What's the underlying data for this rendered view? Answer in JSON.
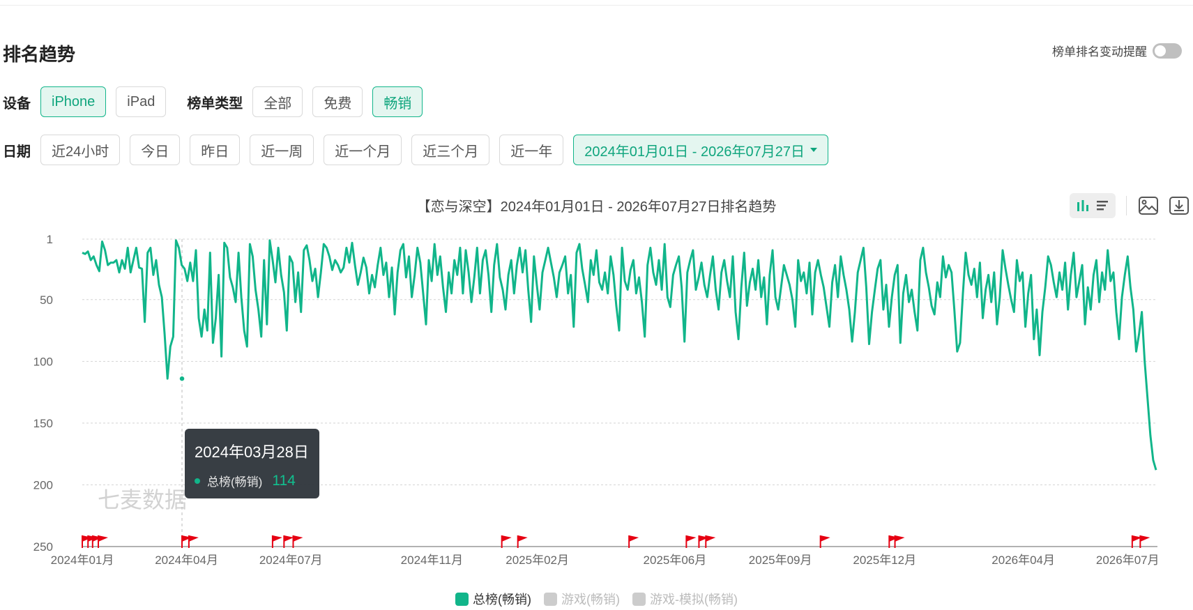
{
  "section_title": "排名趋势",
  "alert_label": "榜单排名变动提醒",
  "device": {
    "label": "设备",
    "options": [
      {
        "label": "iPhone",
        "active": true
      },
      {
        "label": "iPad",
        "active": false
      }
    ]
  },
  "list_type": {
    "label": "榜单类型",
    "options": [
      {
        "label": "全部",
        "active": false
      },
      {
        "label": "免费",
        "active": false
      },
      {
        "label": "畅销",
        "active": true
      }
    ]
  },
  "date": {
    "label": "日期",
    "options": [
      "近24小时",
      "今日",
      "昨日",
      "近一周",
      "近一个月",
      "近三个月",
      "近一年"
    ],
    "range": "2024年01月01日 - 2026年07月27日"
  },
  "chart_data": {
    "type": "line",
    "title": "【恋与深空】2024年01月01日 - 2026年07月27日排名趋势",
    "y_axis": {
      "ticks": [
        1,
        50,
        100,
        150,
        200,
        250
      ],
      "inverted": true,
      "range": [
        1,
        250
      ]
    },
    "x_axis": {
      "ticks": [
        "2024年01月",
        "2024年04月",
        "2024年07月",
        "2024年11月",
        "2025年02月",
        "2025年06月",
        "2025年09月",
        "2025年12月",
        "2026年04月",
        "2026年07月"
      ]
    },
    "watermark": "七麦数据",
    "colors": {
      "primary": "#11b58a",
      "inactive": "#cccccc",
      "flag": "#e60012"
    },
    "series": [
      {
        "name": "总榜(畅销)",
        "active": true,
        "values": [
          12,
          13,
          11,
          18,
          15,
          22,
          27,
          3,
          10,
          22,
          20,
          20,
          18,
          28,
          18,
          25,
          8,
          28,
          18,
          8,
          24,
          25,
          68,
          12,
          8,
          30,
          18,
          38,
          48,
          78,
          114,
          88,
          80,
          2,
          8,
          22,
          25,
          35,
          20,
          35,
          10,
          65,
          80,
          58,
          75,
          12,
          85,
          65,
          30,
          96,
          4,
          8,
          32,
          40,
          52,
          12,
          48,
          75,
          88,
          5,
          15,
          42,
          58,
          80,
          18,
          70,
          2,
          18,
          36,
          8,
          30,
          44,
          75,
          15,
          20,
          52,
          28,
          60,
          10,
          6,
          18,
          35,
          25,
          48,
          28,
          5,
          8,
          15,
          26,
          18,
          22,
          28,
          24,
          8,
          20,
          4,
          22,
          38,
          28,
          16,
          24,
          45,
          30,
          40,
          22,
          8,
          30,
          20,
          48,
          24,
          62,
          28,
          10,
          5,
          32,
          15,
          48,
          30,
          8,
          20,
          45,
          70,
          18,
          35,
          5,
          30,
          15,
          40,
          60,
          28,
          45,
          18,
          30,
          8,
          45,
          10,
          28,
          52,
          32,
          8,
          45,
          18,
          10,
          30,
          60,
          22,
          5,
          32,
          42,
          58,
          30,
          18,
          45,
          22,
          8,
          28,
          10,
          42,
          68,
          15,
          38,
          58,
          28,
          18,
          8,
          20,
          32,
          48,
          28,
          22,
          15,
          45,
          30,
          72,
          12,
          5,
          25,
          38,
          52,
          18,
          30,
          10,
          36,
          42,
          28,
          45,
          15,
          30,
          55,
          75,
          8,
          35,
          42,
          26,
          18,
          45,
          32,
          52,
          80,
          22,
          8,
          28,
          38,
          18,
          42,
          5,
          48,
          56,
          30,
          22,
          15,
          40,
          84,
          28,
          18,
          10,
          42,
          32,
          20,
          38,
          48,
          30,
          15,
          42,
          58,
          28,
          18,
          35,
          48,
          15,
          60,
          82,
          40,
          12,
          55,
          36,
          25,
          42,
          18,
          48,
          32,
          70,
          30,
          10,
          48,
          58,
          40,
          22,
          30,
          38,
          50,
          72,
          18,
          35,
          28,
          45,
          20,
          62,
          28,
          18,
          30,
          40,
          56,
          72,
          36,
          22,
          48,
          15,
          30,
          42,
          58,
          84,
          60,
          28,
          18,
          8,
          40,
          86,
          60,
          42,
          25,
          18,
          58,
          38,
          72,
          48,
          30,
          22,
          85,
          45,
          30,
          52,
          42,
          60,
          75,
          18,
          8,
          28,
          40,
          55,
          62,
          36,
          48,
          15,
          32,
          22,
          28,
          58,
          92,
          85,
          45,
          12,
          30,
          38,
          25,
          48,
          20,
          65,
          42,
          30,
          52,
          28,
          70,
          48,
          10,
          25,
          38,
          50,
          60,
          18,
          35,
          28,
          72,
          45,
          30,
          82,
          58,
          95,
          60,
          40,
          15,
          22,
          36,
          48,
          28,
          42,
          20,
          58,
          30,
          12,
          48,
          35,
          22,
          70,
          40,
          58,
          30,
          18,
          52,
          28,
          42,
          10,
          35,
          28,
          60,
          82,
          48,
          30,
          15,
          40,
          58,
          92,
          78,
          60,
          100,
          130,
          160,
          180,
          188
        ]
      },
      {
        "name": "游戏(畅销)",
        "active": false,
        "values": []
      },
      {
        "name": "游戏-模拟(畅销)",
        "active": false,
        "values": []
      }
    ],
    "flags": [
      "2024-01-01",
      "2024-01-06",
      "2024-01-10",
      "2024-01-15",
      "2024-03-28",
      "2024-04-03",
      "2024-06-15",
      "2024-06-25",
      "2024-07-03",
      "2025-01-01",
      "2025-01-15",
      "2025-04-22",
      "2025-06-11",
      "2025-06-22",
      "2025-06-28",
      "2025-10-06",
      "2025-12-05",
      "2025-12-10",
      "2026-07-05",
      "2026-07-12"
    ],
    "tooltip": {
      "date": "2024年03月28日",
      "series": "总榜(畅销)",
      "value": 114
    }
  }
}
